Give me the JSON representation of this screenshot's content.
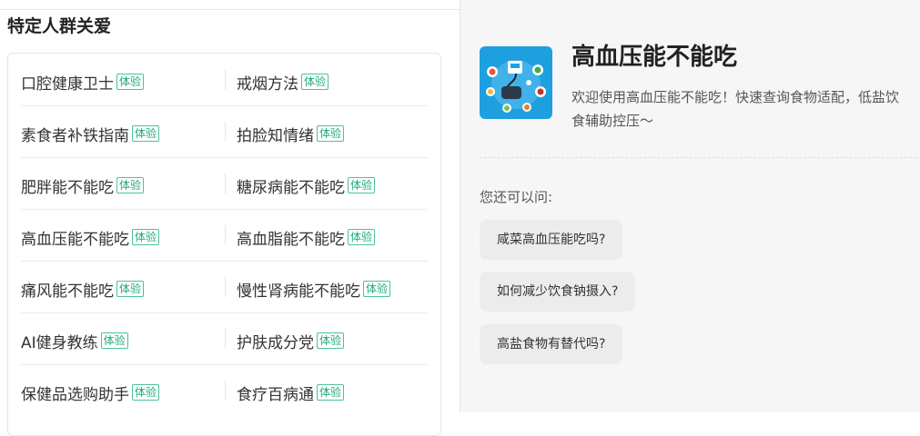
{
  "left": {
    "section_title": "特定人群关爱",
    "tag_label": "体验",
    "rows": [
      {
        "left": "口腔健康卫士",
        "right": "戒烟方法"
      },
      {
        "left": "素食者补铁指南",
        "right": "拍脸知情绪"
      },
      {
        "left": "肥胖能不能吃",
        "right": "糖尿病能不能吃"
      },
      {
        "left": "高血压能不能吃",
        "right": "高血脂能不能吃"
      },
      {
        "left": "痛风能不能吃",
        "right": "慢性肾病能不能吃"
      },
      {
        "left": "AI健身教练",
        "right": "护肤成分党"
      },
      {
        "left": "保健品选购助手",
        "right": "食疗百病通"
      }
    ]
  },
  "right": {
    "app_title": "高血压能不能吃",
    "app_desc": "欢迎使用高血压能不能吃！快速查询食物适配，低盐饮食辅助控压～",
    "ask_label": "您还可以问:",
    "suggestions": [
      "咸菜高血压能吃吗?",
      "如何减少饮食钠摄入?",
      "高盐食物有替代吗?"
    ],
    "icon_name": "blood-pressure-food-icon"
  },
  "colors": {
    "tag_green": "#1ea97c",
    "icon_bg": "#1e9fe0",
    "panel_bg": "#f6f6f6"
  }
}
